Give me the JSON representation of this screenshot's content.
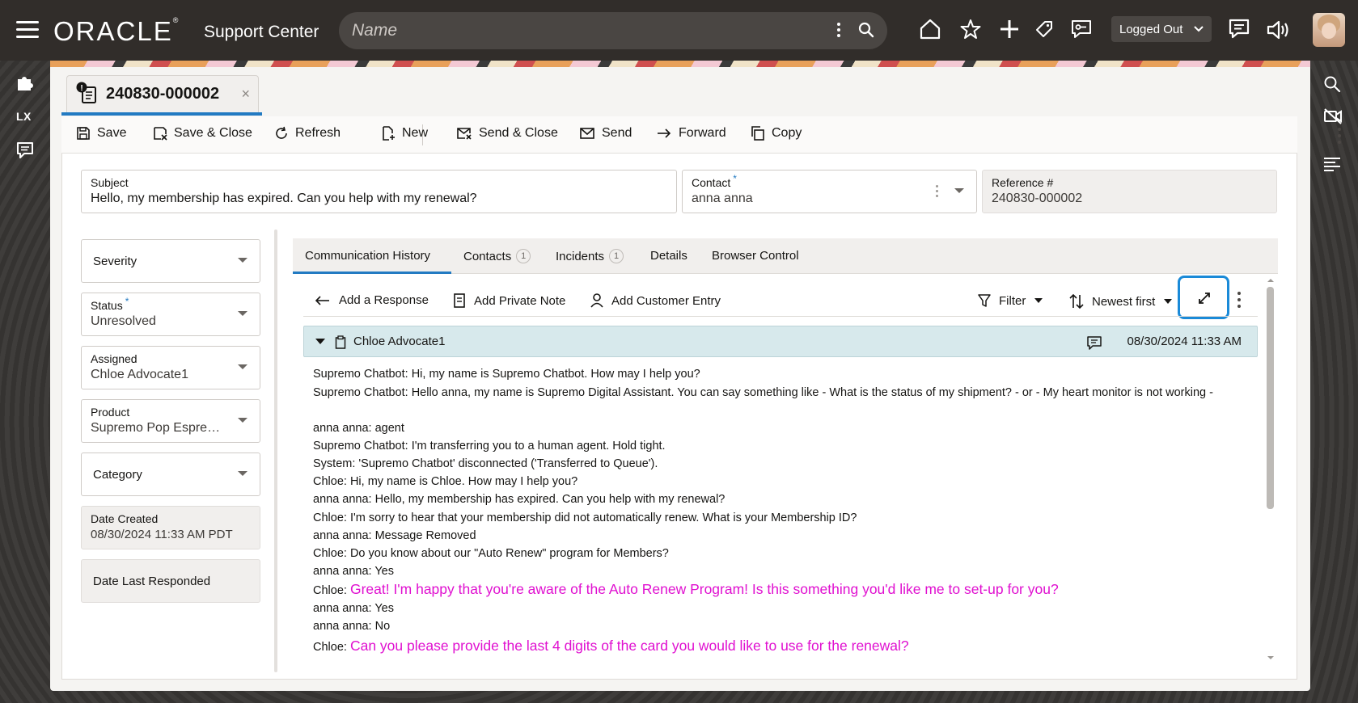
{
  "header": {
    "logo": "ORACLE",
    "logo_mark": "®",
    "app_name": "Support Center",
    "search_placeholder": "Name",
    "status_select": "Logged Out"
  },
  "left_rail": {
    "lx_label": "LX"
  },
  "record_tab": {
    "title": "240830-000002",
    "close": "×"
  },
  "toolbar": {
    "save": "Save",
    "save_close": "Save & Close",
    "refresh": "Refresh",
    "new": "New",
    "send_close": "Send & Close",
    "send": "Send",
    "forward": "Forward",
    "copy": "Copy"
  },
  "form": {
    "subject_label": "Subject",
    "subject_value": "Hello, my membership has expired. Can you help with my renewal?",
    "contact_label": "Contact",
    "contact_value": "anna anna",
    "reference_label": "Reference #",
    "reference_value": "240830-000002",
    "required_mark": "*"
  },
  "side_fields": {
    "severity_label": "Severity",
    "status_label": "Status",
    "status_value": "Unresolved",
    "assigned_label": "Assigned",
    "assigned_value": "Chloe Advocate1",
    "product_label": "Product",
    "product_value": "Supremo Pop Espresso",
    "category_label": "Category",
    "date_created_label": "Date Created",
    "date_created_value": "08/30/2024 11:33 AM PDT",
    "date_last_responded_label": "Date Last Responded"
  },
  "tabs": {
    "communication_history": "Communication History",
    "contacts": "Contacts",
    "contacts_count": "1",
    "incidents": "Incidents",
    "incidents_count": "1",
    "details": "Details",
    "browser_control": "Browser Control"
  },
  "history_toolbar": {
    "add_response": "Add a Response",
    "add_private_note": "Add Private Note",
    "add_customer_entry": "Add Customer Entry",
    "filter": "Filter",
    "sort": "Newest first"
  },
  "entry": {
    "author": "Chloe Advocate1",
    "timestamp": "08/30/2024 11:33 AM",
    "lines": [
      {
        "prefix": "Supremo Chatbot: Hi, my name is Supremo Chatbot. How may I help you?",
        "highlight": ""
      },
      {
        "prefix": "Supremo Chatbot: Hello anna, my name is Supremo Digital Assistant. You can say something like - What is the status of my shipment? - or - My heart monitor is not working -",
        "highlight": ""
      },
      {
        "prefix": "anna anna: agent",
        "highlight": ""
      },
      {
        "prefix": "Supremo Chatbot: I'm transferring you to a human agent. Hold tight.",
        "highlight": ""
      },
      {
        "prefix": "System: 'Supremo Chatbot' disconnected ('Transferred to Queue').",
        "highlight": ""
      },
      {
        "prefix": "Chloe: Hi, my name is Chloe. How may I help you?",
        "highlight": ""
      },
      {
        "prefix": "anna anna: Hello, my membership has expired. Can you help with my renewal?",
        "highlight": ""
      },
      {
        "prefix": "Chloe: I'm sorry to hear that your membership did not automatically renew. What is your Membership ID?",
        "highlight": ""
      },
      {
        "prefix": "anna anna: Message Removed",
        "highlight": ""
      },
      {
        "prefix": "Chloe: Do you know about our \"Auto Renew\" program for Members?",
        "highlight": ""
      },
      {
        "prefix": "anna anna: Yes",
        "highlight": ""
      },
      {
        "prefix": "Chloe: ",
        "highlight": "Great! I'm happy that you're aware of the Auto Renew Program! Is this something you'd like me to set-up for you?"
      },
      {
        "prefix": "anna anna: Yes",
        "highlight": ""
      },
      {
        "prefix": "anna anna: No",
        "highlight": ""
      },
      {
        "prefix": "Chloe: ",
        "highlight": "Can you please provide the last 4 digits of the card you would like to use for the renewal?"
      }
    ]
  },
  "colors": {
    "brand_dark": "#312d2a",
    "accent_blue": "#227ac2",
    "highlight_magenta": "#e010d0",
    "entry_header_bg": "#d7e9ec"
  }
}
